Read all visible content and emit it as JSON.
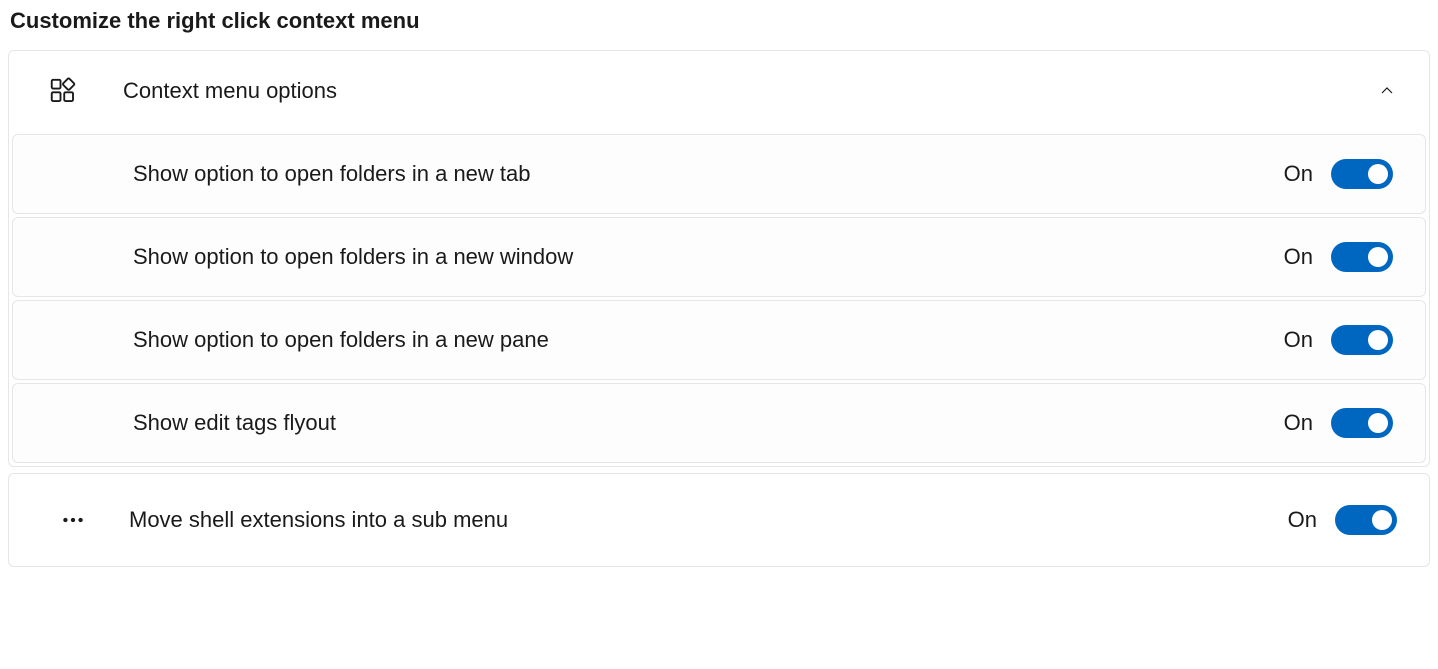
{
  "section": {
    "title": "Customize the right click context menu"
  },
  "expander": {
    "icon": "apps-icon",
    "title": "Context menu options",
    "expanded": true,
    "items": [
      {
        "label": "Show option to open folders in a new tab",
        "state": "On"
      },
      {
        "label": "Show option to open folders in a new window",
        "state": "On"
      },
      {
        "label": "Show option to open folders in a new pane",
        "state": "On"
      },
      {
        "label": "Show edit tags flyout",
        "state": "On"
      }
    ]
  },
  "standalone": {
    "icon": "more-icon",
    "label": "Move shell extensions into a sub menu",
    "state": "On"
  }
}
